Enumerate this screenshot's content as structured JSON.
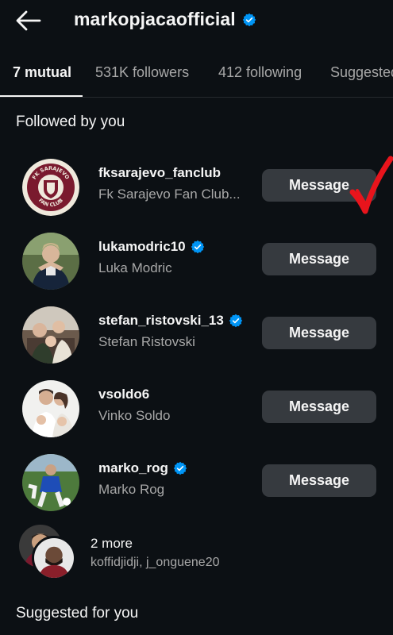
{
  "header": {
    "title": "markopjacaofficial",
    "verified": true
  },
  "tabs": [
    {
      "label": "7 mutual",
      "active": true
    },
    {
      "label": "531K followers",
      "active": false
    },
    {
      "label": "412 following",
      "active": false
    },
    {
      "label": "Suggested",
      "active": false
    }
  ],
  "section_followed": "Followed by you",
  "accounts": [
    {
      "username": "fksarajevo_fanclub",
      "full_name": "Fk Sarajevo Fan Club...",
      "verified": false,
      "button": "Message",
      "avatar": "fk-sarajevo-logo"
    },
    {
      "username": "lukamodric10",
      "full_name": "Luka Modric",
      "verified": true,
      "button": "Message",
      "avatar": "person-photo"
    },
    {
      "username": "stefan_ristovski_13",
      "full_name": "Stefan Ristovski",
      "verified": true,
      "button": "Message",
      "avatar": "group-photo"
    },
    {
      "username": "vsoldo6",
      "full_name": "Vinko Soldo",
      "verified": false,
      "button": "Message",
      "avatar": "family-photo"
    },
    {
      "username": "marko_rog",
      "full_name": "Marko Rog",
      "verified": true,
      "button": "Message",
      "avatar": "football-photo"
    }
  ],
  "logo_text": {
    "top": "FK SARAJEVO",
    "bottom": "FAN CLUB"
  },
  "more": {
    "count_label": "2 more",
    "names": "koffidjidji, j_onguene20"
  },
  "section_suggested": "Suggested for you",
  "colors": {
    "background": "#0c1014",
    "button_bg": "#363a3f",
    "secondary_text": "#a8a8a8",
    "verified_blue": "#0095f6",
    "annotation_red": "#e8141c",
    "sarajevo_maroon": "#7a1a2e"
  }
}
